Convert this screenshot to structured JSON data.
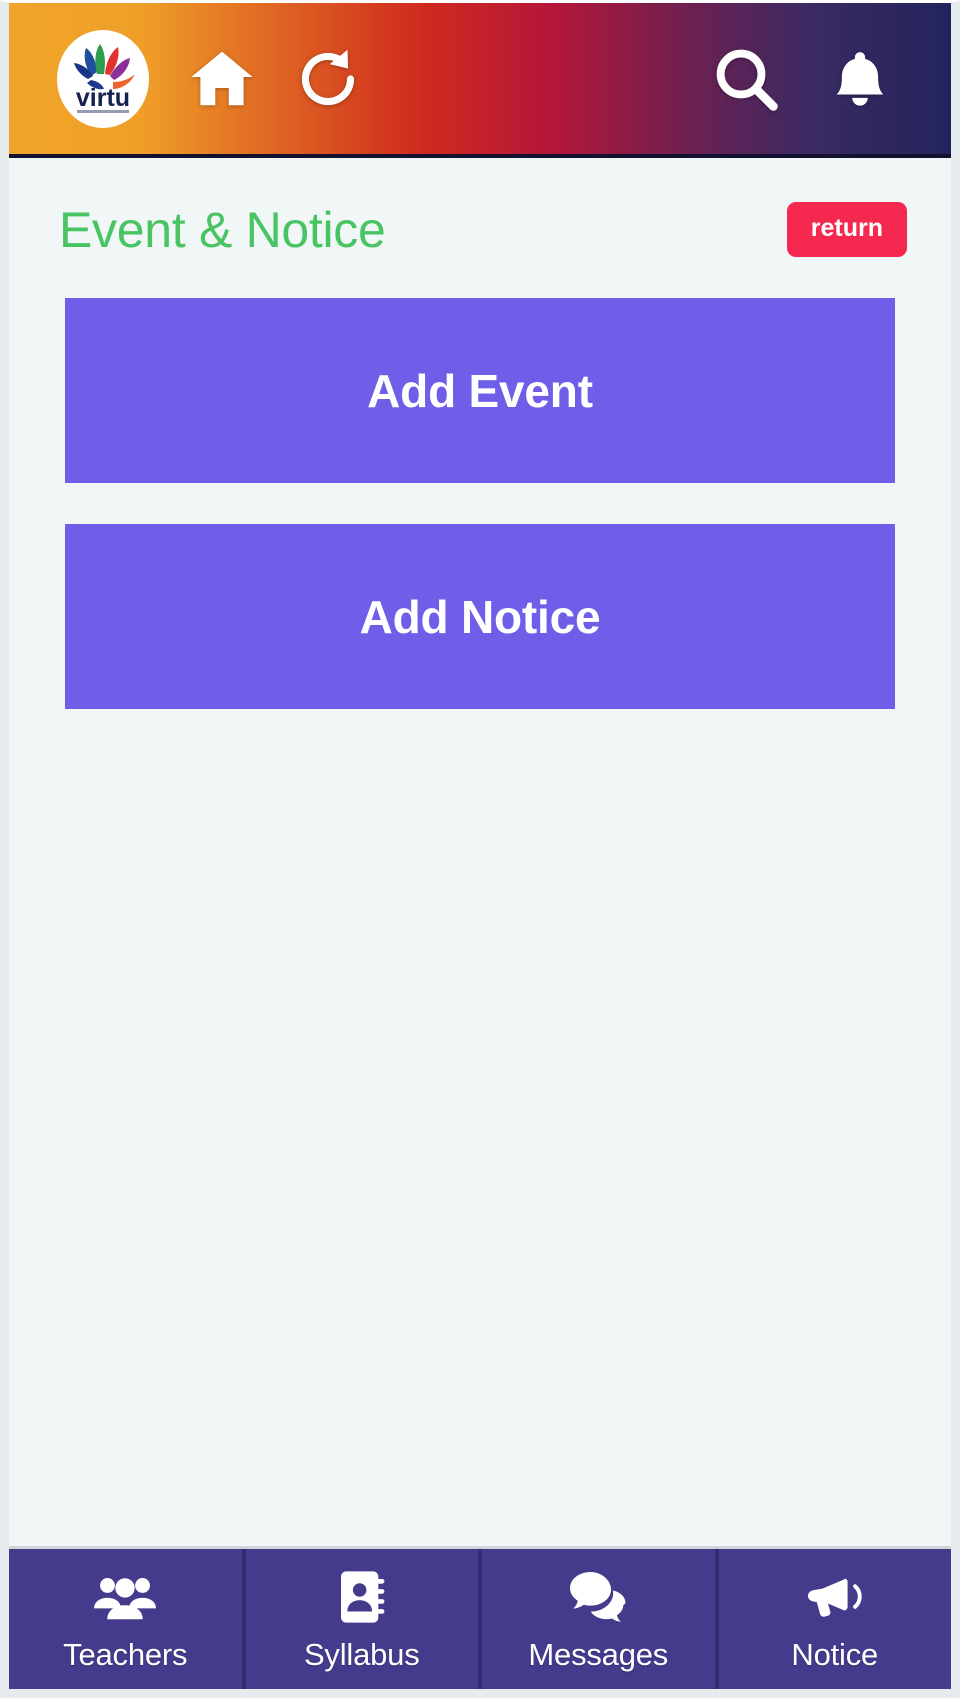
{
  "appbar": {
    "logo": {
      "name": "virtu-logo",
      "text": "virtu"
    },
    "icons": [
      {
        "name": "home-icon",
        "label": "Home"
      },
      {
        "name": "refresh-icon",
        "label": "Refresh"
      },
      {
        "name": "search-icon",
        "label": "Search"
      },
      {
        "name": "bell-icon",
        "label": "Notifications"
      }
    ],
    "gradient_from": "#f0a42a",
    "gradient_mid": "#cf2a1f",
    "gradient_to": "#23245c"
  },
  "page": {
    "title": "Event & Notice",
    "title_color": "#49c463",
    "background": "#f1f6f6"
  },
  "return_button": {
    "label": "return",
    "color": "#f5294f"
  },
  "actions": [
    {
      "label": "Add Event",
      "color": "#6f5fe8"
    },
    {
      "label": "Add Notice",
      "color": "#6f5fe8"
    }
  ],
  "bottom_nav": {
    "background": "#443b8c",
    "items": [
      {
        "label": "Teachers",
        "icon": "users-icon"
      },
      {
        "label": "Syllabus",
        "icon": "address-book-icon"
      },
      {
        "label": "Messages",
        "icon": "comments-icon"
      },
      {
        "label": "Notice",
        "icon": "bullhorn-icon"
      }
    ]
  }
}
